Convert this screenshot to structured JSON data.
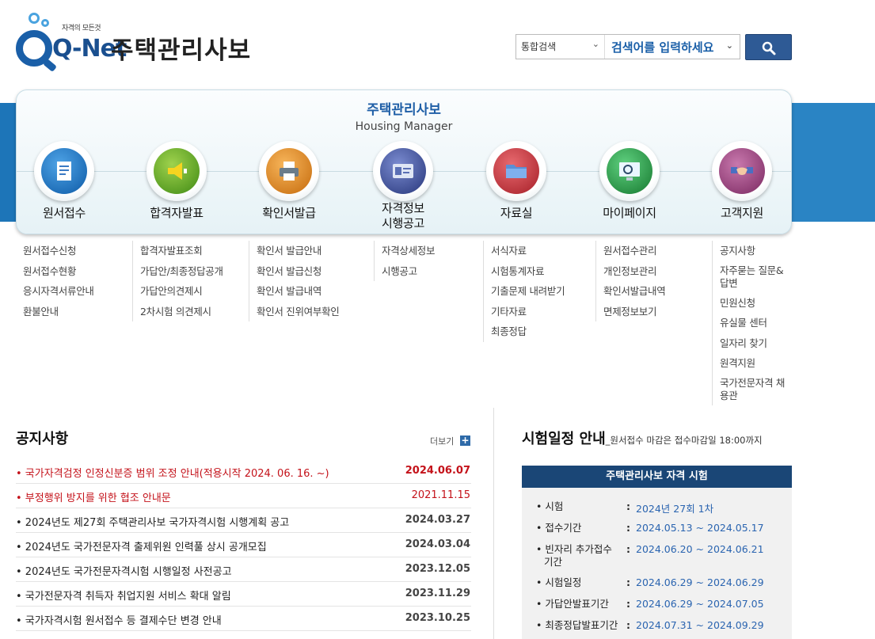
{
  "header": {
    "logo_tagline": "자격의 모든것",
    "logo_text": "Q-Net",
    "site_title": "주택관리사보"
  },
  "search": {
    "scope_label": "통합검색",
    "input_placeholder": "검색어를 입력하세요"
  },
  "menu": {
    "title": "주택관리사보",
    "subtitle": "Housing Manager",
    "items": [
      {
        "label": "원서접수",
        "icon": "document-icon",
        "color": "#1d6fb8"
      },
      {
        "label": "합격자발표",
        "icon": "megaphone-icon",
        "color": "#6aa62a"
      },
      {
        "label": "확인서발급",
        "icon": "printer-icon",
        "color": "#e08a1e"
      },
      {
        "label_line1": "자격정보",
        "label_line2": "시행공고",
        "icon": "id-card-icon",
        "color": "#3c4f9a"
      },
      {
        "label": "자료실",
        "icon": "folder-icon",
        "color": "#c0303a"
      },
      {
        "label": "마이페이지",
        "icon": "monitor-icon",
        "color": "#2c9a4a"
      },
      {
        "label": "고객지원",
        "icon": "handshake-icon",
        "color": "#9a3f7a"
      }
    ]
  },
  "submenus": [
    [
      "원서접수신청",
      "원서접수현황",
      "응시자격서류안내",
      "환불안내"
    ],
    [
      "합격자발표조회",
      "가답안/최종정답공개",
      "가답안의견제시",
      "2차시험 의견제시"
    ],
    [
      "확인서 발급안내",
      "확인서 발급신청",
      "확인서 발급내역",
      "확인서 진위여부확인"
    ],
    [
      "자격상세정보",
      "시행공고"
    ],
    [
      "서식자료",
      "시험통계자료",
      "기출문제 내려받기",
      "기타자료",
      "최종정답"
    ],
    [
      "원서접수관리",
      "개인정보관리",
      "확인서발급내역",
      "면제정보보기"
    ],
    [
      "공지사항",
      "자주묻는 질문&답변",
      "민원신청",
      "유실물 센터",
      "일자리 찾기",
      "원격지원",
      "국가전문자격 채용관"
    ]
  ],
  "notices": {
    "title": "공지사항",
    "more_label": "더보기",
    "items": [
      {
        "title": "• 국가자격검정 인정신분증 범위 조정 안내(적용시작 2024. 06. 16. ~)",
        "date": "2024.06.07"
      },
      {
        "title": "• 부정행위 방지를 위한 협조 안내문",
        "date": "2021.11.15"
      },
      {
        "title": "• 2024년도 제27회 주택관리사보 국가자격시험 시행계획 공고",
        "date": "2024.03.27"
      },
      {
        "title": "• 2024년도 국가전문자격 출제위원 인력풀 상시 공개모집",
        "date": "2024.03.04"
      },
      {
        "title": "• 2024년도 국가전문자격시험 시행일정 사전공고",
        "date": "2023.12.05"
      },
      {
        "title": "• 국가전문자격 취득자 취업지원 서비스 확대 알림",
        "date": "2023.11.29"
      },
      {
        "title": "• 국가자격시험 원서접수 등 결제수단 변경 안내",
        "date": "2023.10.25"
      }
    ]
  },
  "schedule": {
    "title": "시험일정 안내",
    "note": "_원서접수 마감은 접수마감일 18:00까지",
    "box_title": "주택관리사보 자격 시험",
    "rows": [
      {
        "key": "• 시험",
        "value": "2024년 27회 1차"
      },
      {
        "key": "• 접수기간",
        "value": "2024.05.13 ~ 2024.05.17"
      },
      {
        "key_line1": "• 빈자리 추가접수",
        "key_line2": "기간",
        "value": "2024.06.20 ~ 2024.06.21"
      },
      {
        "key": "• 시험일정",
        "value": "2024.06.29 ~ 2024.06.29"
      },
      {
        "key": "• 가답안발표기간",
        "value": "2024.06.29 ~ 2024.07.05"
      },
      {
        "key": "• 최종정답발표기간",
        "value": "2024.07.31 ~ 2024.09.29"
      }
    ]
  }
}
